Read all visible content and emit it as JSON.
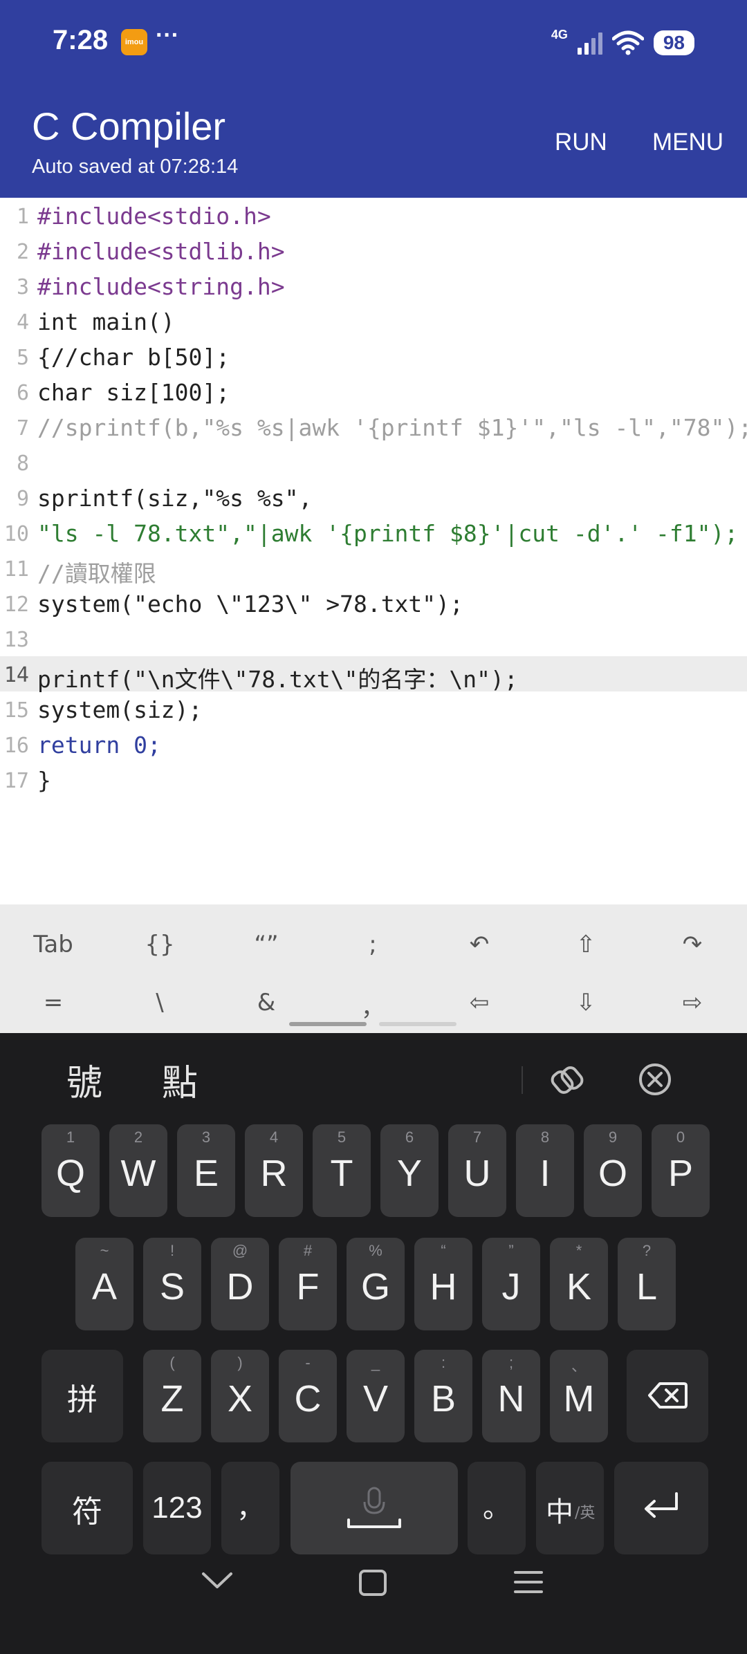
{
  "status_bar": {
    "time": "7:28",
    "app_badge": "imou",
    "more": "···",
    "network": "4G",
    "battery": "98"
  },
  "app_bar": {
    "title": "C Compiler",
    "subtitle": "Auto saved at 07:28:14",
    "run_label": "RUN",
    "menu_label": "MENU"
  },
  "editor": {
    "active_line": 14,
    "line_numbers": [
      "1",
      "2",
      "3",
      "4",
      "5",
      "6",
      "7",
      "8",
      "9",
      "10",
      "11",
      "12",
      "13",
      "14",
      "15",
      "16",
      "17"
    ],
    "lines": [
      "#include<stdio.h>",
      "#include<stdlib.h>",
      "#include<string.h>",
      "int main()",
      "{//char b[50];",
      "char siz[100];",
      "//sprintf(b,\"%s %s|awk '{printf $1}'\",\"ls -l\",\"78\");",
      "",
      "sprintf(siz,\"%s %s\",",
      "\"ls -l 78.txt\",\"|awk '{printf $8}'|cut -d'.' -f1\");",
      "//讀取權限",
      "system(\"echo \\\"123\\\" >78.txt\");",
      "",
      "printf(\"\\n文件\\\"78.txt\\\"的名字：\\n\");",
      "system(siz);",
      "return 0;",
      "}"
    ]
  },
  "accessory_keys": {
    "row1": [
      "Tab",
      "{}",
      "“”",
      ";",
      "↶",
      "⇧",
      "↷"
    ],
    "row2": [
      "=",
      "\\",
      "&",
      "，",
      "⇦",
      "⇩",
      "⇨"
    ]
  },
  "keyboard": {
    "candidates": [
      "號",
      "點"
    ],
    "row1": [
      {
        "key": "Q",
        "sub": "1"
      },
      {
        "key": "W",
        "sub": "2"
      },
      {
        "key": "E",
        "sub": "3"
      },
      {
        "key": "R",
        "sub": "4"
      },
      {
        "key": "T",
        "sub": "5"
      },
      {
        "key": "Y",
        "sub": "6"
      },
      {
        "key": "U",
        "sub": "7"
      },
      {
        "key": "I",
        "sub": "8"
      },
      {
        "key": "O",
        "sub": "9"
      },
      {
        "key": "P",
        "sub": "0"
      }
    ],
    "row2": [
      {
        "key": "A",
        "sub": "~"
      },
      {
        "key": "S",
        "sub": "!"
      },
      {
        "key": "D",
        "sub": "@"
      },
      {
        "key": "F",
        "sub": "#"
      },
      {
        "key": "G",
        "sub": "%"
      },
      {
        "key": "H",
        "sub": "“"
      },
      {
        "key": "J",
        "sub": "”"
      },
      {
        "key": "K",
        "sub": "*"
      },
      {
        "key": "L",
        "sub": "?"
      }
    ],
    "row3": [
      {
        "key": "Z",
        "sub": "("
      },
      {
        "key": "X",
        "sub": ")"
      },
      {
        "key": "C",
        "sub": "-"
      },
      {
        "key": "V",
        "sub": "_"
      },
      {
        "key": "B",
        "sub": ":"
      },
      {
        "key": "N",
        "sub": ";"
      },
      {
        "key": "M",
        "sub": "、"
      }
    ],
    "pinyin_key": "拼",
    "symbols_key": "符",
    "numbers_key": "123",
    "comma_key": "，",
    "period_key": "。",
    "lang_key": "中",
    "lang_sub": "/英"
  },
  "icons": {
    "signal": "signal-icon",
    "wifi": "wifi-icon",
    "clipboard": "clipboard-icon",
    "close_candidates": "close-circle-icon",
    "backspace": "backspace-icon",
    "mic": "mic-icon",
    "enter": "enter-icon",
    "nav_back": "chevron-down-icon",
    "nav_home": "square-icon",
    "nav_menu": "hamburger-icon"
  },
  "colors": {
    "app_bar": "#303f9f",
    "keyword": "#303f9f",
    "string": "#2e7d32",
    "comment": "#9e9e9e",
    "preprocessor": "#7b3a8f"
  }
}
